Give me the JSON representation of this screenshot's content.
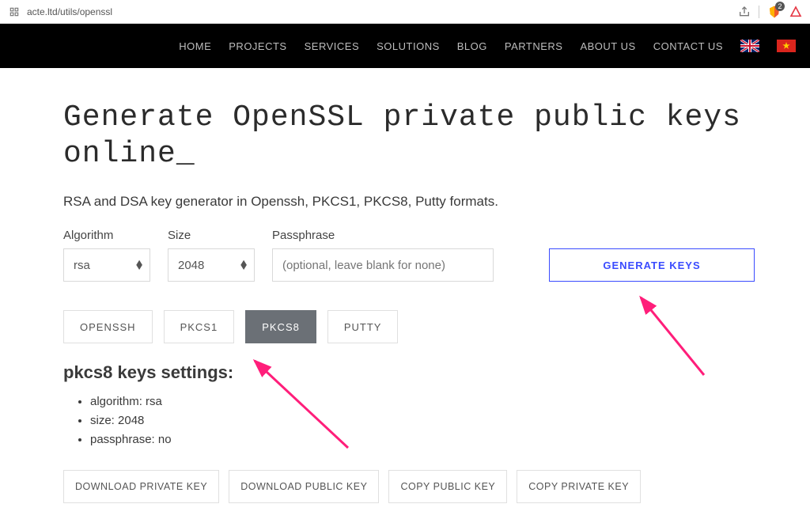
{
  "browser": {
    "url": "acte.ltd/utils/openssl",
    "shield_badge": "2"
  },
  "nav": {
    "items": [
      "HOME",
      "PROJECTS",
      "SERVICES",
      "SOLUTIONS",
      "BLOG",
      "PARTNERS",
      "ABOUT US",
      "CONTACT US"
    ]
  },
  "page": {
    "title": "Generate OpenSSL private public keys online_",
    "subtitle": "RSA and DSA key generator in Openssh, PKCS1, PKCS8, Putty formats."
  },
  "form": {
    "algorithm_label": "Algorithm",
    "algorithm_value": "rsa",
    "size_label": "Size",
    "size_value": "2048",
    "passphrase_label": "Passphrase",
    "passphrase_placeholder": "(optional, leave blank for none)",
    "generate_label": "GENERATE KEYS"
  },
  "tabs": {
    "items": [
      "OPENSSH",
      "PKCS1",
      "PKCS8",
      "PUTTY"
    ],
    "active_index": 2
  },
  "settings": {
    "title": "pkcs8 keys settings:",
    "algorithm": "algorithm: rsa",
    "size": "size: 2048",
    "passphrase": "passphrase: no"
  },
  "actions": {
    "download_private": "DOWNLOAD PRIVATE KEY",
    "download_public": "DOWNLOAD PUBLIC KEY",
    "copy_public": "COPY PUBLIC KEY",
    "copy_private": "COPY PRIVATE KEY"
  }
}
